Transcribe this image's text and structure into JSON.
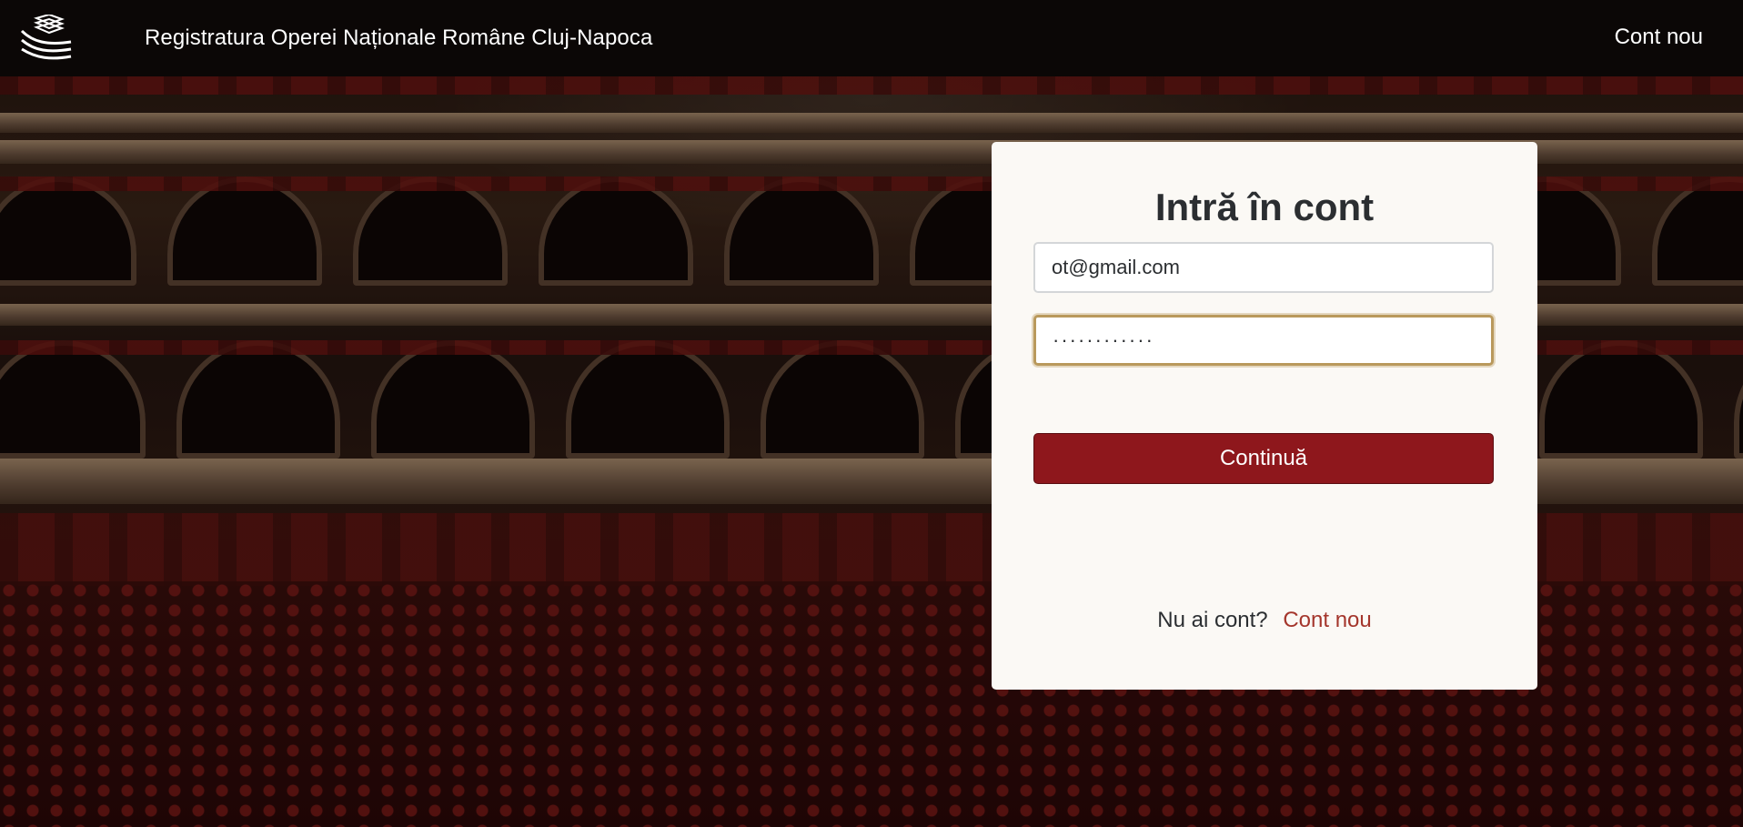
{
  "header": {
    "site_title": "Registratura Operei Naționale Române Cluj-Napoca",
    "signup_link": "Cont nou",
    "logo_icon": "stacked-layers-logo-icon"
  },
  "login": {
    "title": "Intră în cont",
    "email_value": "ot@gmail.com",
    "password_value": "············",
    "continue_label": "Continuă",
    "no_account_text": "Nu ai cont?",
    "signup_link": "Cont nou"
  },
  "colors": {
    "topbar": "#0b0706",
    "card": "#fbf9f5",
    "button": "#8e171c",
    "focus_border": "#b9995c",
    "link": "#a4362c"
  }
}
